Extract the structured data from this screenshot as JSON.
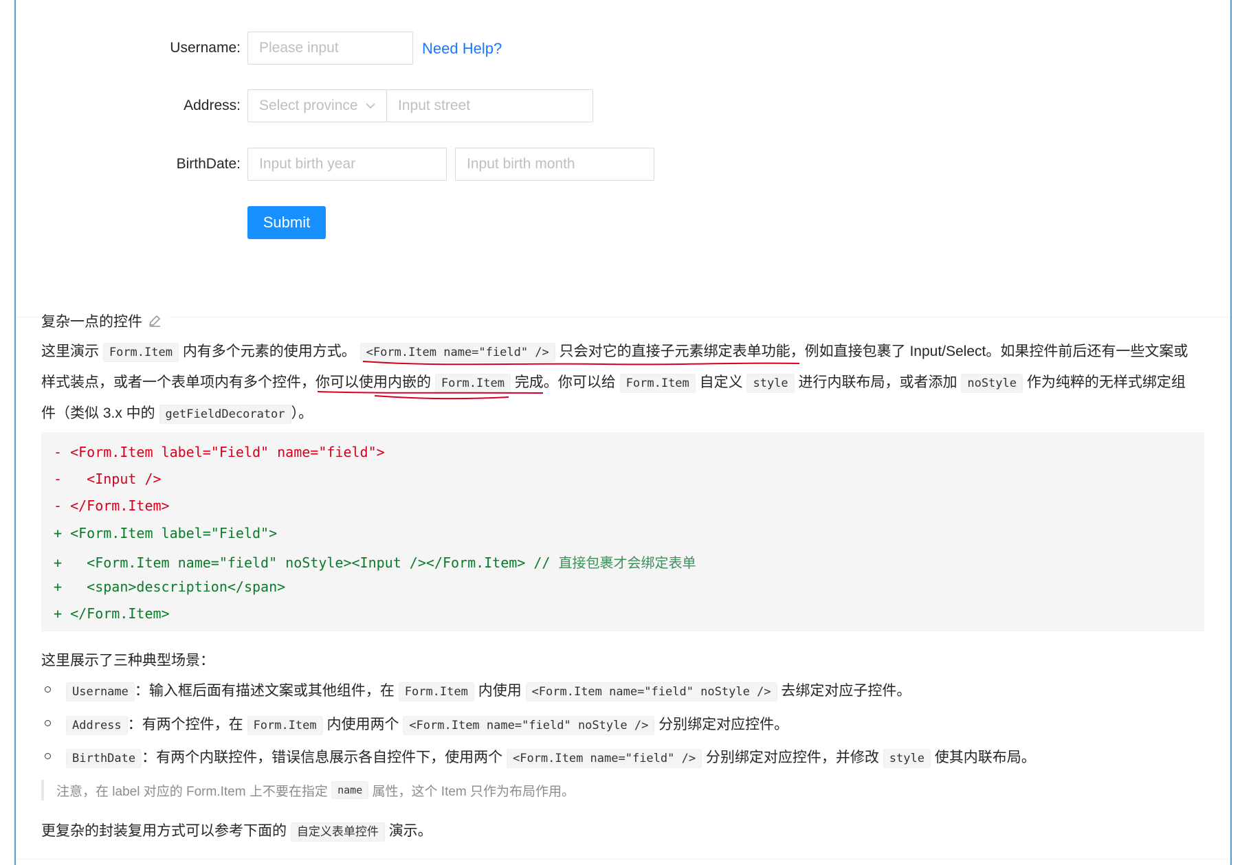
{
  "form": {
    "username": {
      "label": "Username",
      "placeholder": "Please input",
      "help_link": "Need Help?"
    },
    "address": {
      "label": "Address",
      "province_placeholder": "Select province",
      "street_placeholder": "Input street"
    },
    "birthdate": {
      "label": "BirthDate",
      "year_placeholder": "Input birth year",
      "month_placeholder": "Input birth month"
    },
    "submit_label": "Submit",
    "label_colon": ":"
  },
  "doc": {
    "heading": "复杂一点的控件",
    "para1": {
      "t1": "这里演示",
      "c1": "Form.Item",
      "t2": "内有多个元素的使用方式。",
      "c2": "<Form.Item name=\"field\" />",
      "t3": "只会对它的直接子元素绑定表单功能，例如直接包裹了 Input/Select。如果控件前后还有一些文案或",
      "t4": "样式装点，或者一个表单项内有多个控件，你可以使用内嵌的",
      "c3": "Form.Item",
      "t5": "完成。你可以给",
      "c4": "Form.Item",
      "t6": "自定义",
      "c5": "style",
      "t7": "进行内联布局，或者添加",
      "c6": "noStyle",
      "t8": "作为纯粹的无样式绑定组",
      "t9": "件（类似 3.x 中的",
      "c7": "getFieldDecorator",
      "t10": "）。"
    },
    "code_lines": [
      {
        "prefix": "- ",
        "text": "<Form.Item label=\"Field\" name=\"field\">",
        "kind": "del"
      },
      {
        "prefix": "- ",
        "text": "  <Input />",
        "kind": "del"
      },
      {
        "prefix": "- ",
        "text": "</Form.Item>",
        "kind": "del"
      },
      {
        "prefix": "+ ",
        "text": "<Form.Item label=\"Field\">",
        "kind": "add"
      },
      {
        "prefix": "+ ",
        "text": "  <Form.Item name=\"field\" noStyle><Input /></Form.Item> // ",
        "comment": "直接包裹才会绑定表单",
        "kind": "add"
      },
      {
        "prefix": "+ ",
        "text": "  <span>description</span>",
        "kind": "add"
      },
      {
        "prefix": "+ ",
        "text": "</Form.Item>",
        "kind": "add"
      }
    ],
    "scenes_intro": "这里展示了三种典型场景：",
    "scenes": [
      {
        "c1": "Username",
        "t1": "：输入框后面有描述文案或其他组件，在",
        "c2": "Form.Item",
        "t2": "内使用",
        "c3": "<Form.Item name=\"field\" noStyle />",
        "t3": "去绑定对应子控件。"
      },
      {
        "c1": "Address",
        "t1": "：有两个控件，在",
        "c2": "Form.Item",
        "t2": "内使用两个",
        "c3": "<Form.Item name=\"field\" noStyle />",
        "t3": "分别绑定对应控件。"
      },
      {
        "c1": "BirthDate",
        "t1": "：有两个内联控件，错误信息展示各自控件下，使用两个",
        "c2": "<Form.Item name=\"field\" />",
        "t2": "分别绑定对应控件，并修改",
        "c3": "style",
        "t3": "使其内联布局。"
      }
    ],
    "note": {
      "t1": "注意，在 label 对应的 Form.Item 上不要在指定",
      "c1": "name",
      "t2": "属性，这个 Item 只作为布局作用。"
    },
    "footer": {
      "t1": "更复杂的封装复用方式可以参考下面的",
      "c1": "自定义表单控件",
      "t2": "演示。"
    }
  },
  "colors": {
    "primary": "#1890ff",
    "link": "#1677ff",
    "annotation": "#d6001c",
    "code_del": "#d6001c",
    "code_add": "#0a7a2a"
  }
}
